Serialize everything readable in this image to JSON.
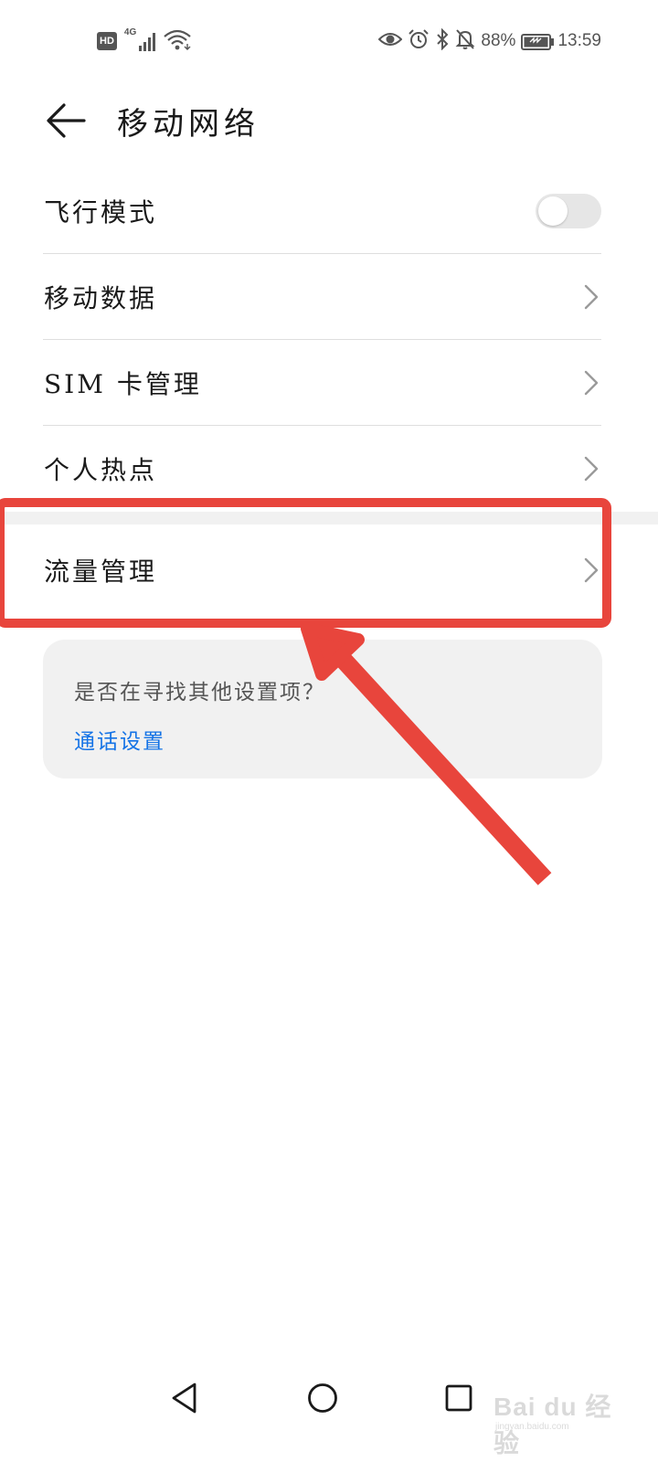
{
  "status_bar": {
    "hd_badge": "HD",
    "network_type": "4G",
    "battery_percent": "88%",
    "time": "13:59",
    "icons": [
      "hd-icon",
      "signal-icon",
      "wifi-icon",
      "eye-icon",
      "alarm-icon",
      "bluetooth-icon",
      "mute-icon",
      "battery-icon"
    ]
  },
  "header": {
    "title": "移动网络",
    "back_icon": "arrow-left-icon"
  },
  "list": {
    "items": [
      {
        "label": "飞行模式",
        "control": "toggle",
        "toggle_on": false
      },
      {
        "label": "移动数据",
        "control": "chevron"
      },
      {
        "label": "SIM 卡管理",
        "control": "chevron"
      },
      {
        "label": "个人热点",
        "control": "chevron"
      },
      {
        "label": "流量管理",
        "control": "chevron",
        "highlighted": true
      }
    ]
  },
  "suggestion": {
    "question": "是否在寻找其他设置项？",
    "link": "通话设置"
  },
  "nav_bar": {
    "icons": [
      "back-triangle-icon",
      "home-circle-icon",
      "recents-square-icon"
    ]
  },
  "watermark": {
    "main": "Bai du 经验",
    "sub": "jingyan.baidu.com"
  },
  "colors": {
    "background": "#ffffff",
    "link": "#1473e6",
    "annotation": "#e8453c",
    "card": "#f1f1f1",
    "toggle_off": "#e6e6e6"
  }
}
